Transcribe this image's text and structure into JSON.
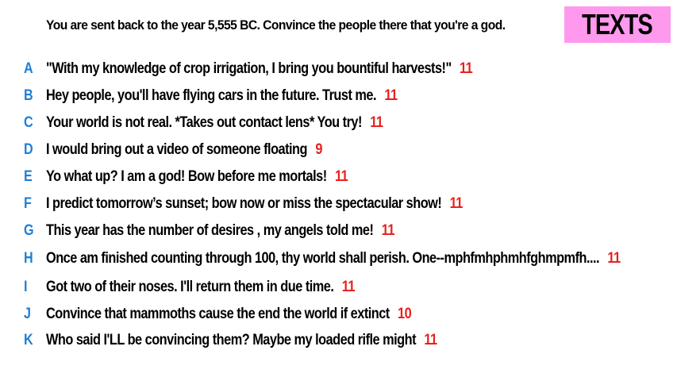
{
  "prompt": "You are sent back to the year 5,555 BC. Convince the people there that you're a god.",
  "badge": "TEXTS",
  "colors": {
    "badge_bg": "#ff99ee",
    "letter": "#1f7fd6",
    "score": "#e8201c"
  },
  "answers": [
    {
      "letter": "A",
      "text": "\"With my knowledge of crop irrigation, I bring you bountiful harvests!\"",
      "score": "11"
    },
    {
      "letter": "B",
      "text": "Hey people, you'll have flying cars in the future. Trust me.",
      "score": "11"
    },
    {
      "letter": "C",
      "text": "Your world is not real. *Takes out contact lens* You try!",
      "score": "11"
    },
    {
      "letter": "D",
      "text": "I would bring out a video of someone floating",
      "score": "9"
    },
    {
      "letter": "E",
      "text": "Yo what up? I am a god! Bow before me mortals!",
      "score": "11"
    },
    {
      "letter": "F",
      "text": "I predict tomorrow’s sunset; bow now or miss the spectacular show!",
      "score": "11"
    },
    {
      "letter": "G",
      "text": "This year has the number of desires , my angels told me!",
      "score": "11"
    },
    {
      "letter": "H",
      "text": "Once am finished counting through 100, thy world shall perish. One--mphfmhphmhfghmpmfh....",
      "score": "11"
    },
    {
      "letter": "I",
      "text": "Got two of their noses. I'll return them in due time.",
      "score": "11"
    },
    {
      "letter": "J",
      "text": "Convince that mammoths cause the end the world if extinct",
      "score": "10"
    },
    {
      "letter": "K",
      "text": "Who said I'LL be convincing them? Maybe my loaded rifle might",
      "score": "11"
    }
  ]
}
